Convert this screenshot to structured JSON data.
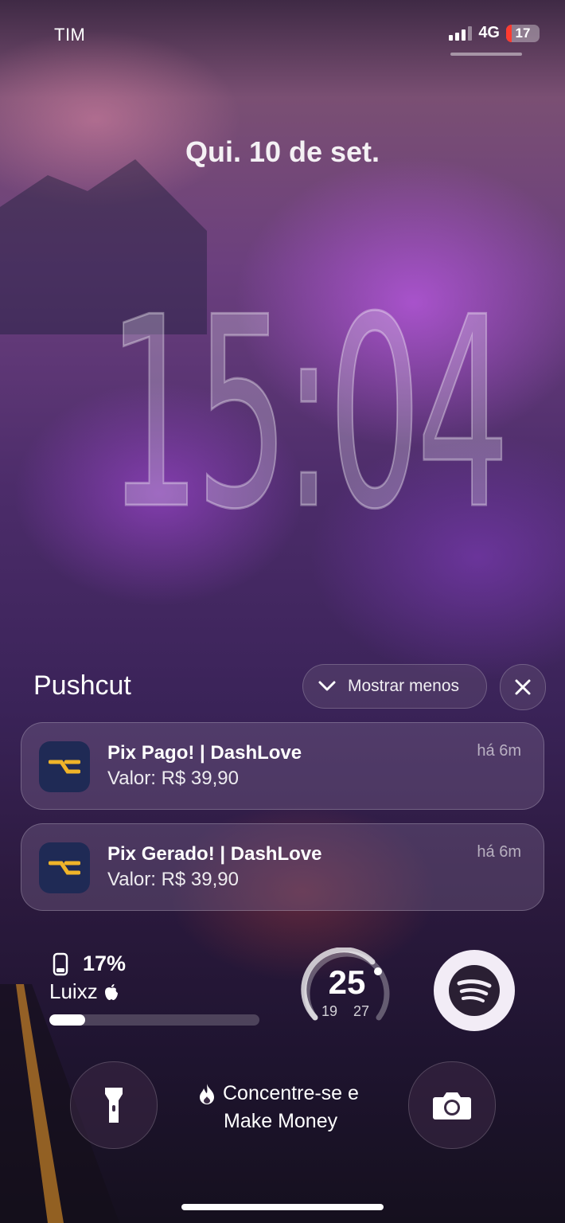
{
  "status_bar": {
    "carrier": "TIM",
    "network": "4G",
    "battery": "17",
    "signal_icon": "signal-bars-icon"
  },
  "lock_screen": {
    "date": "Qui. 10 de set.",
    "time": "15:04"
  },
  "notification_group": {
    "app_name": "Pushcut",
    "show_less_label": "Mostrar menos",
    "items": [
      {
        "title": "Pix Pago! | DashLove",
        "body": "Valor: R$ 39,90",
        "time": "há 6m"
      },
      {
        "title": "Pix Gerado! | DashLove",
        "body": "Valor: R$ 39,90",
        "time": "há 6m"
      }
    ]
  },
  "widgets": {
    "battery": {
      "percent": "17%",
      "device": "Luixz",
      "level": 0.17
    },
    "weather": {
      "temp": "25",
      "low": "19",
      "high": "27"
    },
    "spotify": {
      "icon": "spotify-icon"
    }
  },
  "focus": {
    "line1": "Concentre-se e",
    "line2": "Make Money",
    "icon": "flame-icon"
  },
  "colors": {
    "battery_low": "#ff3b30",
    "app_icon_bg": "#1f2a55",
    "app_icon_fg": "#f0b429"
  }
}
